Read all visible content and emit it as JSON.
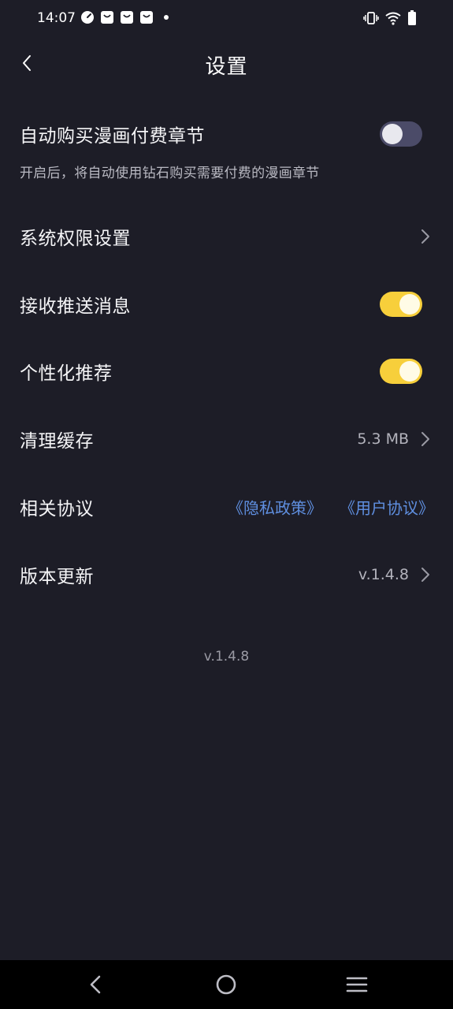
{
  "status_bar": {
    "time": "14:07",
    "left_icons": [
      "speedometer-icon",
      "notification-bag-icon",
      "notification-bag-icon",
      "notification-bag-icon",
      "dot-icon"
    ],
    "right_icons": [
      "vibrate-icon",
      "wifi-icon",
      "battery-icon"
    ]
  },
  "header": {
    "title": "设置",
    "back_icon": "chevron-left-icon"
  },
  "settings": {
    "auto_buy": {
      "label": "自动购买漫画付费章节",
      "description": "开启后，将自动使用钻石购买需要付费的漫画章节",
      "enabled": false
    },
    "permissions": {
      "label": "系统权限设置"
    },
    "push": {
      "label": "接收推送消息",
      "enabled": true
    },
    "personalized": {
      "label": "个性化推荐",
      "enabled": true
    },
    "cache": {
      "label": "清理缓存",
      "value": "5.3 MB"
    },
    "agreements": {
      "label": "相关协议",
      "privacy": "《隐私政策》",
      "user": "《用户协议》"
    },
    "update": {
      "label": "版本更新",
      "value": "v.1.4.8"
    }
  },
  "footer": {
    "version": "v.1.4.8"
  },
  "colors": {
    "background": "#1d1d27",
    "accent": "#f7cf3b",
    "link": "#5f8fe0",
    "toggle_off": "#4b4b68"
  },
  "nav_bar": {
    "icons": [
      "back-triangle-icon",
      "home-circle-icon",
      "menu-lines-icon"
    ]
  }
}
